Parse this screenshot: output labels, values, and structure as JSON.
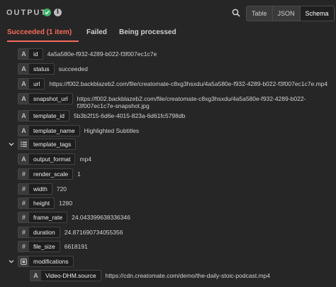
{
  "header": {
    "title": "OUTPUT",
    "views": [
      {
        "label": "Table",
        "active": false
      },
      {
        "label": "JSON",
        "active": false
      },
      {
        "label": "Schema",
        "active": true
      }
    ]
  },
  "tabs": [
    {
      "label": "Succeeded (1 item)",
      "active": true
    },
    {
      "label": "Failed",
      "active": false
    },
    {
      "label": "Being processed",
      "active": false
    }
  ],
  "rows": [
    {
      "type": "A",
      "key": "id",
      "value": "4a5a580e-f932-4289-b022-f3f007ec1c7e"
    },
    {
      "type": "A",
      "key": "status",
      "value": "succeeded"
    },
    {
      "type": "A",
      "key": "url",
      "value": "https://f002.backblazeb2.com/file/creatomate-c8xg3hsxdu/4a5a580e-f932-4289-b022-f3f007ec1c7e.mp4"
    },
    {
      "type": "A",
      "key": "snapshot_url",
      "value": "https://f002.backblazeb2.com/file/creatomate-c8xg3hsxdu/4a5a580e-f932-4289-b022-f3f007ec1c7e-snapshot.jpg"
    },
    {
      "type": "A",
      "key": "template_id",
      "value": "5b3b2f15-6d6e-4015-823a-6d61fc5798db"
    },
    {
      "type": "A",
      "key": "template_name",
      "value": "Highlighted Subtitles"
    },
    {
      "type": "list",
      "key": "template_tags",
      "value": ""
    },
    {
      "type": "A",
      "key": "output_format",
      "value": "mp4"
    },
    {
      "type": "#",
      "key": "render_scale",
      "value": "1"
    },
    {
      "type": "#",
      "key": "width",
      "value": "720"
    },
    {
      "type": "#",
      "key": "height",
      "value": "1280"
    },
    {
      "type": "#",
      "key": "frame_rate",
      "value": "24.043399638336346"
    },
    {
      "type": "#",
      "key": "duration",
      "value": "24.871690734055356"
    },
    {
      "type": "#",
      "key": "file_size",
      "value": "6618191"
    },
    {
      "type": "obj",
      "key": "modifications",
      "value": ""
    },
    {
      "type": "A",
      "key": "Video-DHM.source",
      "value": "https://cdn.creatomate.com/demo/the-daily-stoic-podcast.mp4"
    }
  ]
}
